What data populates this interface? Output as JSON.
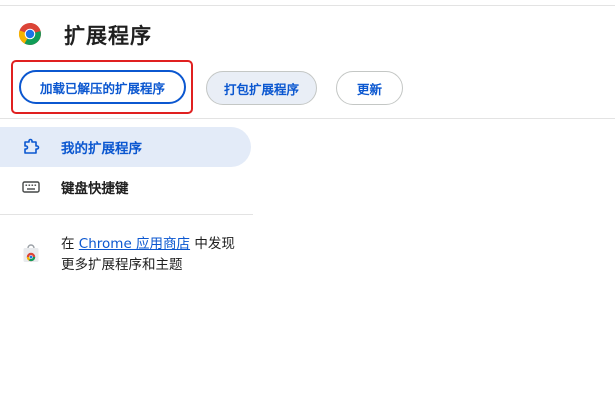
{
  "header": {
    "title": "扩展程序",
    "load_button": "加载已解压的扩展程序",
    "pack_button": "打包扩展程序",
    "update_button": "更新"
  },
  "sidebar": {
    "items": [
      {
        "label": "我的扩展程序",
        "icon": "puzzle-piece-icon",
        "active": true
      },
      {
        "label": "键盘快捷键",
        "icon": "keyboard-icon",
        "active": false
      }
    ]
  },
  "store": {
    "prefix": "在 ",
    "link": "Chrome 应用商店",
    "suffix": " 中发现更多扩展程序和主题",
    "icon": "web-store-icon"
  },
  "colors": {
    "accent": "#0b57d0",
    "active_bg": "#e3ebf8",
    "highlight_box": "#e02020"
  }
}
